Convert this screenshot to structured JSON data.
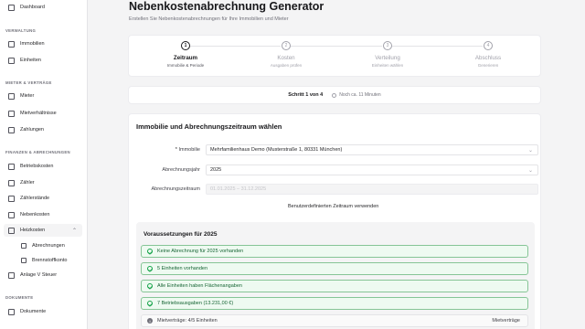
{
  "sidebar": {
    "dashboard": "Dashboard",
    "section_verwaltung": "VERWALTUNG",
    "immobilien": "Immobilien",
    "einheiten": "Einheiten",
    "section_mieter": "MIETER & VERTRÄGE",
    "mieter": "Mieter",
    "mietverhaeltnisse": "Mietverhältnisse",
    "zahlungen": "Zahlungen",
    "section_finanzen": "FINANZEN & ABRECHNUNGEN",
    "betriebskosten": "Betriebskosten",
    "zaehler": "Zähler",
    "zaehlerstaende": "Zählerstände",
    "nebenkosten": "Nebenkosten",
    "heizkosten": "Heizkosten",
    "abrechnungen": "Abrechnungen",
    "brennstoffkonto": "Brennstoffkonto",
    "anlage_v": "Anlage V Steuer",
    "section_dokumente": "DOKUMENTE",
    "dokumente": "Dokumente"
  },
  "page": {
    "title": "Nebenkostenabrechnung Generator",
    "subtitle": "Erstellen Sie Nebenkostenabrechnungen für Ihre Immobilien und Mieter"
  },
  "stepper": {
    "steps": [
      {
        "num": "1",
        "title": "Zeitraum",
        "sub": "Immobilie & Periode"
      },
      {
        "num": "2",
        "title": "Kosten",
        "sub": "Ausgaben prüfen"
      },
      {
        "num": "3",
        "title": "Verteilung",
        "sub": "Einheiten wählen"
      },
      {
        "num": "4",
        "title": "Abschluss",
        "sub": "Generieren"
      }
    ],
    "current_step": 1
  },
  "stepbar": {
    "step_text": "Schritt 1 von 4",
    "time_text": "Noch ca. 11 Minuten"
  },
  "form": {
    "title": "Immobilie und Abrechnungszeitraum wählen",
    "immobilie_req": "*",
    "immobilie_label": "Immobilie",
    "immobilie_value": "Mehrfamilienhaus Demo (Musterstraße 1, 80331 München)",
    "jahr_label": "Abrechnungsjahr",
    "jahr_value": "2025",
    "zeitraum_label": "Abrechnungszeitraum",
    "zeitraum_value": "01.01.2025 – 31.12.2025",
    "custom_button": "Benutzerdefinierten Zeitraum verwenden"
  },
  "requirements": {
    "title": "Voraussetzungen für 2025",
    "checks": [
      "Keine Abrechnung für 2025 vorhanden",
      "5 Einheiten vorhanden",
      "Alle Einheiten haben Flächenangaben",
      "7 Betriebsausgaben (13.231,00 €)"
    ],
    "info_text": "Mietverträge: 4/5 Einheiten",
    "info_link": "Mietverträge"
  },
  "colors": {
    "success_border": "#86c596",
    "success_bg": "#eefaf1",
    "success_text": "#166534"
  }
}
